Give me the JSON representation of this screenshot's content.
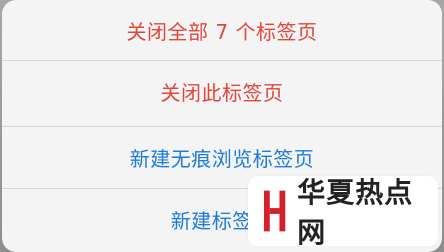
{
  "action_sheet": {
    "items": [
      {
        "label": "关闭全部 7 个标签页",
        "style": "destructive"
      },
      {
        "label": "关闭此标签页",
        "style": "destructive"
      },
      {
        "label": "新建无痕浏览标签页",
        "style": "default"
      },
      {
        "label": "新建标签页",
        "style": "default"
      }
    ]
  },
  "watermark": {
    "text": "华夏热点网",
    "logo_color": "#d4202a"
  },
  "colors": {
    "destructive": "#e0463a",
    "default": "#1e7bd8"
  }
}
